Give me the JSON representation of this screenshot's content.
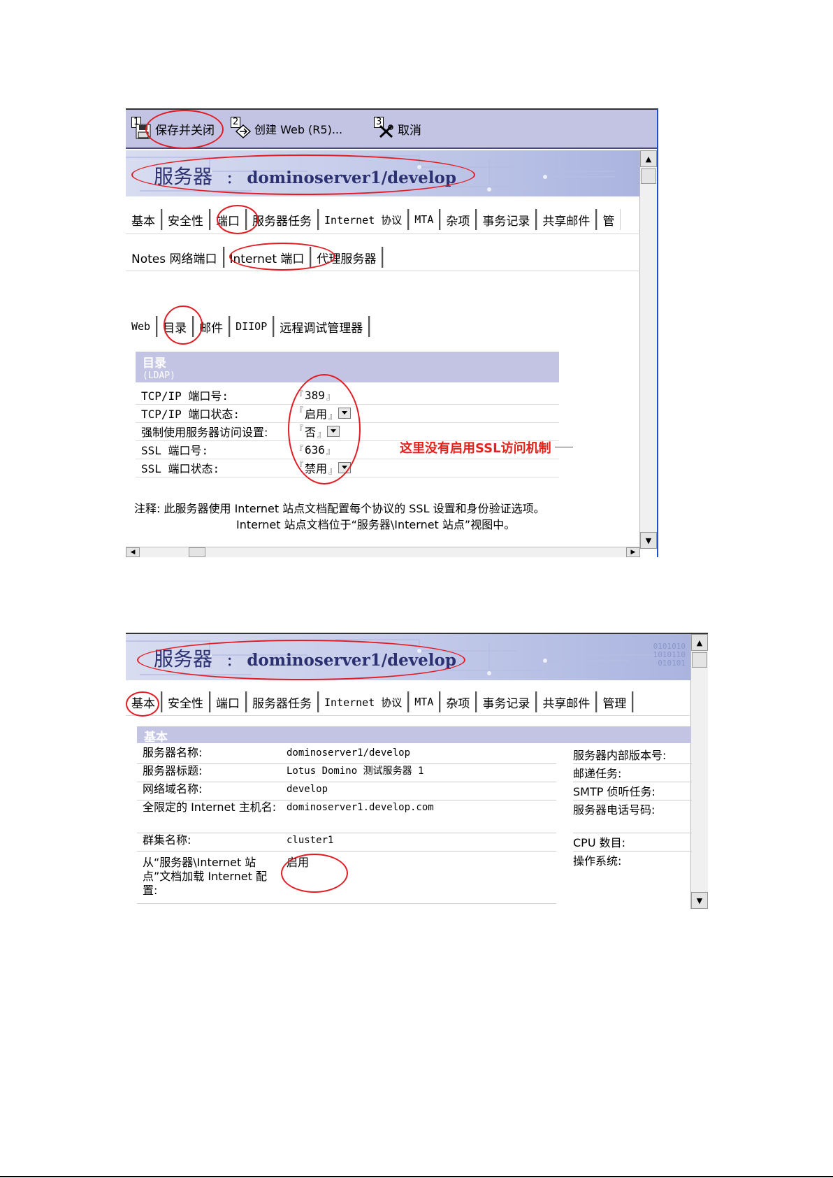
{
  "toolbar": {
    "save_close": {
      "num": "1",
      "label": "保存并关闭"
    },
    "create_web": {
      "num": "2",
      "label": "创建 Web (R5)..."
    },
    "cancel": {
      "num": "3",
      "label": "取消"
    }
  },
  "banner": {
    "label": "服务器",
    "colon": ":",
    "server": "dominoserver1/develop",
    "binary": [
      "0101010",
      "1010110",
      "010101"
    ]
  },
  "main_tabs": [
    "基本",
    "安全性",
    "端口",
    "服务器任务",
    "Internet 协议",
    "MTA",
    "杂项",
    "事务记录",
    "共享邮件",
    "管"
  ],
  "port_tabs": [
    "Notes 网络端口",
    "Internet 端口",
    "代理服务器"
  ],
  "internet_tabs": [
    "Web",
    "目录",
    "邮件",
    "DIIOP",
    "远程调试管理器"
  ],
  "ldap_section": {
    "title": "目录",
    "subtitle": "(LDAP)",
    "rows": [
      {
        "label": "TCP/IP 端口号:",
        "value": "389"
      },
      {
        "label": "TCP/IP 端口状态:",
        "value": "启用"
      },
      {
        "label": "强制使用服务器访问设置:",
        "value": "否"
      },
      {
        "label": "SSL 端口号:",
        "value": "636"
      },
      {
        "label": "SSL 端口状态:",
        "value": "禁用"
      }
    ],
    "annotation": "这里没有启用SSL访问机制",
    "note_line1": "注释: 此服务器使用 Internet 站点文档配置每个协议的 SSL 设置和身份验证选项。",
    "note_line2": "Internet 站点文档位于“服务器\\Internet 站点”视图中。"
  },
  "second": {
    "banner": {
      "label": "服务器",
      "colon": ":",
      "server": "dominoserver1/develop",
      "binary": [
        "0101010",
        "1010110",
        "010101"
      ]
    },
    "tabs": [
      "基本",
      "安全性",
      "端口",
      "服务器任务",
      "Internet 协议",
      "MTA",
      "杂项",
      "事务记录",
      "共享邮件",
      "管理"
    ],
    "section_title": "基本",
    "rows": [
      {
        "label": "服务器名称:",
        "value": "dominoserver1/develop"
      },
      {
        "label": "服务器标题:",
        "value": "Lotus Domino 测试服务器 1"
      },
      {
        "label": "网络域名称:",
        "value": "develop"
      },
      {
        "label": "全限定的 Internet 主机名:",
        "value": "dominoserver1.develop.com"
      },
      {
        "label": "群集名称:",
        "value": "cluster1"
      },
      {
        "label": "从“服务器\\Internet 站点”文档加载 Internet 配置:",
        "value": "启用"
      }
    ],
    "right_labels": [
      "服务器内部版本号:",
      "邮递任务:",
      "SMTP 侦听任务:",
      "服务器电话号码:",
      "CPU 数目:",
      "操作系统:"
    ]
  },
  "colors": {
    "toolbar_bg": "#c3c3e3",
    "section_header": "#c3c3e3",
    "banner_text": "#2b3070",
    "annotation_red": "#e8201c"
  }
}
